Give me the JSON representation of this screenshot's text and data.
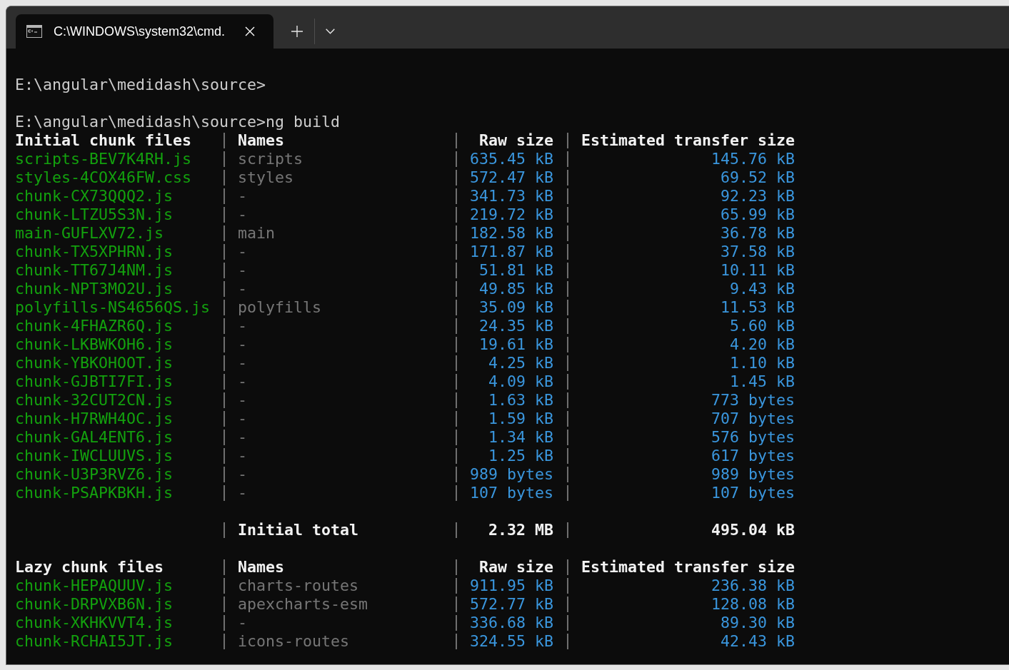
{
  "window": {
    "tabs": [
      {
        "title": "C:\\WINDOWS\\system32\\cmd.",
        "selected": true
      }
    ]
  },
  "console_lines": [
    "E:\\angular\\medidash\\source>",
    "E:\\angular\\medidash\\source>ng build"
  ],
  "initial_chunks": {
    "columns": [
      "Initial chunk files",
      "Names",
      "Raw size",
      "Estimated transfer size"
    ],
    "rows": [
      {
        "file": "scripts-BEV7K4RH.js",
        "name": "scripts",
        "raw_size": "635.45 kB",
        "transfer_size": "145.76 kB"
      },
      {
        "file": "styles-4COX46FW.css",
        "name": "styles",
        "raw_size": "572.47 kB",
        "transfer_size": "69.52 kB"
      },
      {
        "file": "chunk-CX73QQQ2.js",
        "name": "-",
        "raw_size": "341.73 kB",
        "transfer_size": "92.23 kB"
      },
      {
        "file": "chunk-LTZU5S3N.js",
        "name": "-",
        "raw_size": "219.72 kB",
        "transfer_size": "65.99 kB"
      },
      {
        "file": "main-GUFLXV72.js",
        "name": "main",
        "raw_size": "182.58 kB",
        "transfer_size": "36.78 kB"
      },
      {
        "file": "chunk-TX5XPHRN.js",
        "name": "-",
        "raw_size": "171.87 kB",
        "transfer_size": "37.58 kB"
      },
      {
        "file": "chunk-TT67J4NM.js",
        "name": "-",
        "raw_size": "51.81 kB",
        "transfer_size": "10.11 kB"
      },
      {
        "file": "chunk-NPT3MO2U.js",
        "name": "-",
        "raw_size": "49.85 kB",
        "transfer_size": "9.43 kB"
      },
      {
        "file": "polyfills-NS4656QS.js",
        "name": "polyfills",
        "raw_size": "35.09 kB",
        "transfer_size": "11.53 kB"
      },
      {
        "file": "chunk-4FHAZR6Q.js",
        "name": "-",
        "raw_size": "24.35 kB",
        "transfer_size": "5.60 kB"
      },
      {
        "file": "chunk-LKBWKOH6.js",
        "name": "-",
        "raw_size": "19.61 kB",
        "transfer_size": "4.20 kB"
      },
      {
        "file": "chunk-YBKOHOOT.js",
        "name": "-",
        "raw_size": "4.25 kB",
        "transfer_size": "1.10 kB"
      },
      {
        "file": "chunk-GJBTI7FI.js",
        "name": "-",
        "raw_size": "4.09 kB",
        "transfer_size": "1.45 kB"
      },
      {
        "file": "chunk-32CUT2CN.js",
        "name": "-",
        "raw_size": "1.63 kB",
        "transfer_size": "773 bytes"
      },
      {
        "file": "chunk-H7RWH4OC.js",
        "name": "-",
        "raw_size": "1.59 kB",
        "transfer_size": "707 bytes"
      },
      {
        "file": "chunk-GAL4ENT6.js",
        "name": "-",
        "raw_size": "1.34 kB",
        "transfer_size": "576 bytes"
      },
      {
        "file": "chunk-IWCLUUVS.js",
        "name": "-",
        "raw_size": "1.25 kB",
        "transfer_size": "617 bytes"
      },
      {
        "file": "chunk-U3P3RVZ6.js",
        "name": "-",
        "raw_size": "989 bytes",
        "transfer_size": "989 bytes"
      },
      {
        "file": "chunk-PSAPKBKH.js",
        "name": "-",
        "raw_size": "107 bytes",
        "transfer_size": "107 bytes"
      }
    ],
    "total": {
      "label": "Initial total",
      "raw_size": "2.32 MB",
      "transfer_size": "495.04 kB"
    }
  },
  "lazy_chunks": {
    "columns": [
      "Lazy chunk files",
      "Names",
      "Raw size",
      "Estimated transfer size"
    ],
    "rows": [
      {
        "file": "chunk-HEPAQUUV.js",
        "name": "charts-routes",
        "raw_size": "911.95 kB",
        "transfer_size": "236.38 kB"
      },
      {
        "file": "chunk-DRPVXB6N.js",
        "name": "apexcharts-esm",
        "raw_size": "572.77 kB",
        "transfer_size": "128.08 kB"
      },
      {
        "file": "chunk-XKHKVVT4.js",
        "name": "-",
        "raw_size": "336.68 kB",
        "transfer_size": "89.30 kB"
      },
      {
        "file": "chunk-RCHAI5JT.js",
        "name": "icons-routes",
        "raw_size": "324.55 kB",
        "transfer_size": "42.43 kB"
      }
    ]
  }
}
